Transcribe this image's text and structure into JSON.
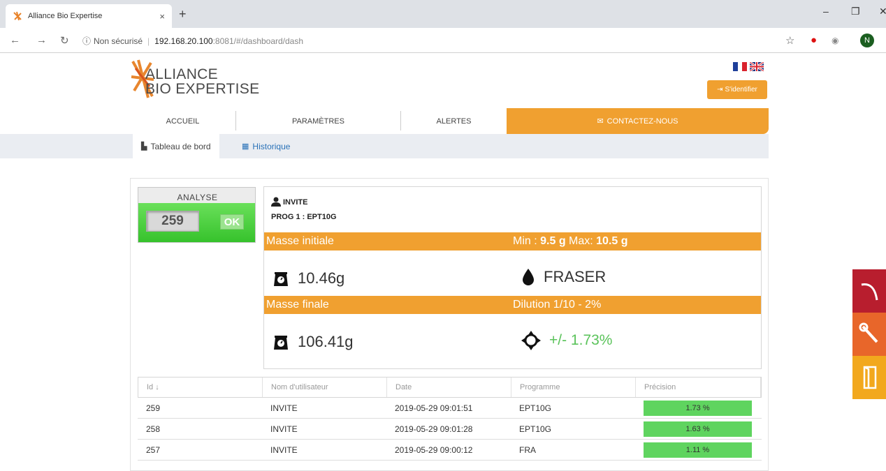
{
  "browser": {
    "tab_title": "Alliance Bio Expertise",
    "tab_close": "×",
    "new_tab": "+",
    "security_label": "Non sécurisé",
    "url_host": "192.168.20.100",
    "url_path": ":8081/#/dashboard/dash",
    "profile_initial": "N"
  },
  "site": {
    "logo_line1": "ALLIANCE",
    "logo_line2": "BIO EXPERTISE",
    "login_label": "S'identifier",
    "nav": {
      "home": "ACCUEIL",
      "params": "PARAMÈTRES",
      "alerts": "ALERTES",
      "contact": "CONTACTEZ-NOUS"
    },
    "subnav": {
      "dashboard": "Tableau de bord",
      "history": "Historique"
    }
  },
  "analyse": {
    "label": "ANALYSE",
    "number": "259",
    "status": "OK"
  },
  "info": {
    "user": "INVITE",
    "program": "PROG 1 : EPT10G",
    "band1_left": "Masse initiale",
    "band1_min_label": "Min : ",
    "band1_min": "9.5 g",
    "band1_max_label": " Max: ",
    "band1_max": "10.5 g",
    "initial_mass": "10.46g",
    "medium": "FRASER",
    "band2_left": "Masse finale",
    "band2_right": "Dilution 1/10 - 2%",
    "final_mass": "106.41g",
    "precision": "+/- 1.73%"
  },
  "table": {
    "headers": [
      "Id ↓",
      "Nom d'utilisateur",
      "Date",
      "Programme",
      "Précision"
    ],
    "rows": [
      {
        "id": "259",
        "user": "INVITE",
        "date": "2019-05-29 09:01:51",
        "program": "EPT10G",
        "precision": "1.73 %"
      },
      {
        "id": "258",
        "user": "INVITE",
        "date": "2019-05-29 09:01:28",
        "program": "EPT10G",
        "precision": "1.63 %"
      },
      {
        "id": "257",
        "user": "INVITE",
        "date": "2019-05-29 09:00:12",
        "program": "FRA",
        "precision": "1.11 %"
      }
    ]
  },
  "colors": {
    "accent_orange": "#f0a030",
    "ok_green": "#36c22c",
    "side_red": "#b81e2e",
    "side_orange": "#e8662a",
    "side_yellow": "#f2a81d"
  }
}
